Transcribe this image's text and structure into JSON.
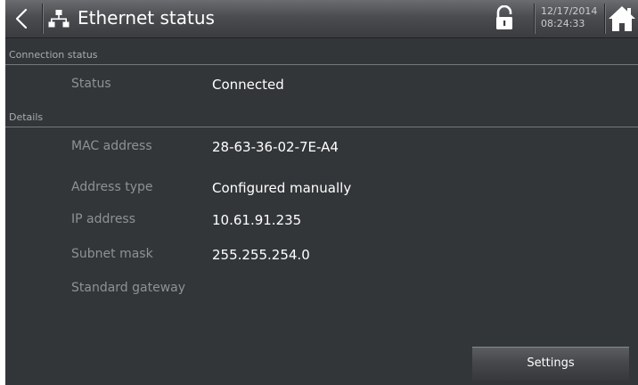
{
  "header": {
    "title": "Ethernet status",
    "date": "12/17/2014",
    "time": "08:24:33",
    "icons": {
      "back": "chevron-left-icon",
      "title": "network-icon",
      "lock": "unlocked-icon",
      "home": "home-icon"
    }
  },
  "sections": {
    "connection": {
      "title": "Connection status",
      "rows": [
        {
          "label": "Status",
          "value": "Connected"
        }
      ]
    },
    "details": {
      "title": "Details",
      "rows": [
        {
          "label": "MAC address",
          "value": "28-63-36-02-7E-A4"
        },
        {
          "label": "Address type",
          "value": "Configured manually"
        },
        {
          "label": "IP address",
          "value": "10.61.91.235"
        },
        {
          "label": "Subnet mask",
          "value": "255.255.254.0"
        },
        {
          "label": "Standard gateway",
          "value": ""
        }
      ]
    }
  },
  "footer": {
    "settings_label": "Settings"
  },
  "colors": {
    "background": "#333639",
    "header": "#4a4c4f",
    "label": "#8f9194",
    "value": "#ffffff"
  }
}
